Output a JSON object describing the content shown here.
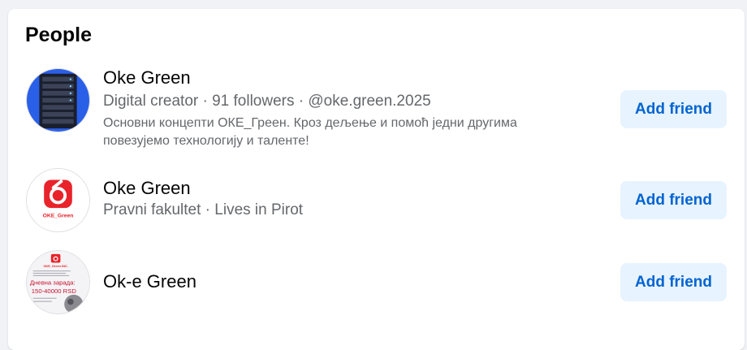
{
  "section": {
    "title": "People"
  },
  "people": [
    {
      "name": "Oke Green",
      "meta": "Digital creator · 91 followers · @oke.green.2025",
      "bio": "Основни концепти ОКЕ_Греен. Кроз дељење и помоћ једни другима повезујемо технологију и таленте!",
      "button_label": "Add friend"
    },
    {
      "name": "Oke Green",
      "meta": "Pravni fakultet · Lives in Pirot",
      "button_label": "Add friend",
      "avatar_text": "OKE_Green"
    },
    {
      "name": "Ok-e Green",
      "button_label": "Add friend",
      "avatar_text": {
        "brand": "OKE_Green INC.",
        "headline": "Дневна зарада:",
        "amount": "150-40000 RSD"
      }
    }
  ],
  "colors": {
    "button_bg": "#e7f3ff",
    "button_text": "#0064d1",
    "avatar1_blue": "#2a5fe8",
    "logo_red": "#e8232a"
  }
}
